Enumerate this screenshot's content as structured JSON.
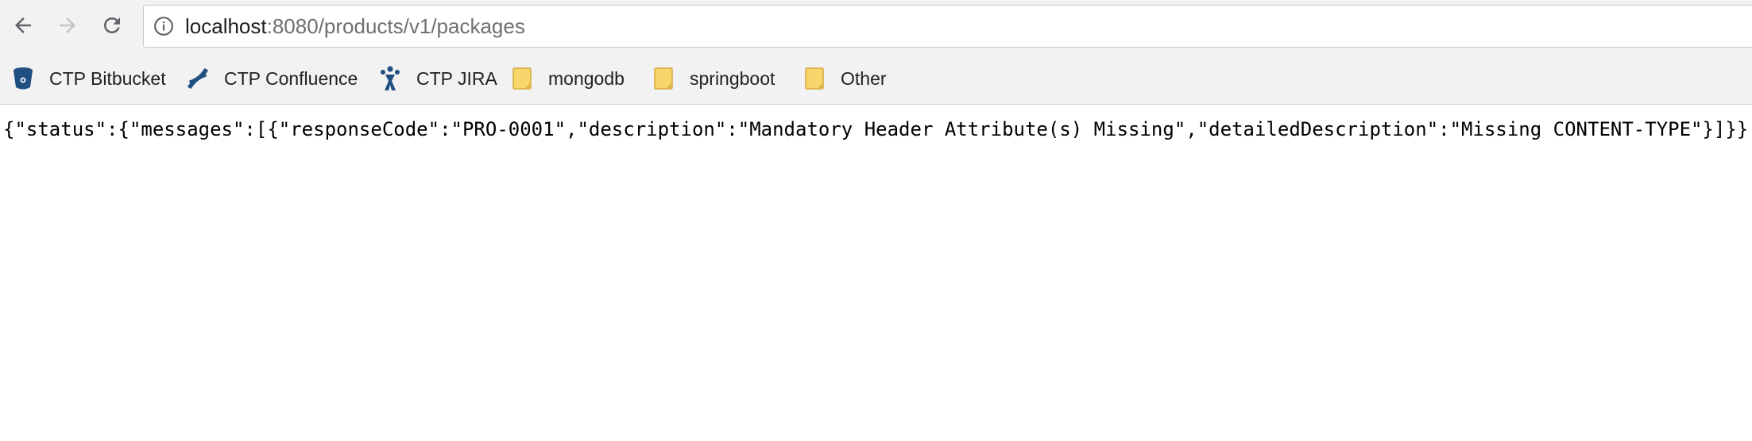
{
  "browser": {
    "nav": {
      "back_icon": "arrow-left-icon",
      "forward_icon": "arrow-right-icon",
      "reload_icon": "reload-icon"
    },
    "address_bar": {
      "security_icon": "info-icon",
      "host": "localhost",
      "path": ":8080/products/v1/packages"
    },
    "bookmarks": [
      {
        "label": "CTP Bitbucket",
        "icon": "bitbucket-icon"
      },
      {
        "label": "CTP Confluence",
        "icon": "confluence-icon"
      },
      {
        "label": "CTP JIRA",
        "icon": "jira-icon"
      },
      {
        "label": "mongodb",
        "icon": "folder-icon"
      },
      {
        "label": "springboot",
        "icon": "folder-icon"
      },
      {
        "label": "Other",
        "icon": "folder-icon"
      }
    ]
  },
  "page": {
    "body_text": "{\"status\":{\"messages\":[{\"responseCode\":\"PRO-0001\",\"description\":\"Mandatory Header Attribute(s) Missing\",\"detailedDescription\":\"Missing CONTENT-TYPE\"}]}}"
  },
  "colors": {
    "chrome_bg": "#f2f2f2",
    "atlassian_blue": "#205081",
    "folder_yellow": "#f9d66b"
  }
}
